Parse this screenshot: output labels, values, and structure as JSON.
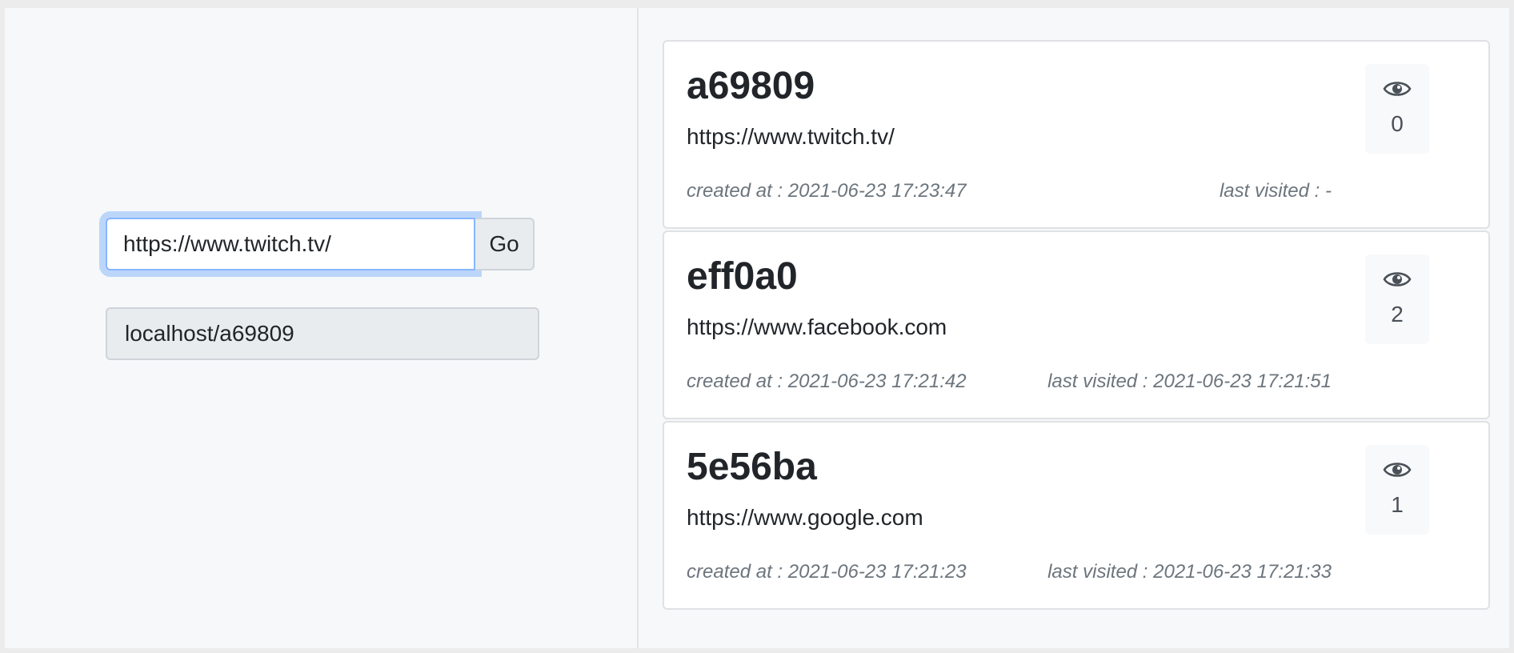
{
  "shortener": {
    "url_input_value": "https://www.twitch.tv/",
    "go_label": "Go",
    "short_url_result": "localhost/a69809"
  },
  "links": [
    {
      "code": "a69809",
      "url": "https://www.twitch.tv/",
      "created": "created at : 2021-06-23 17:23:47",
      "last_visited": "last visited : -",
      "views": "0"
    },
    {
      "code": "eff0a0",
      "url": "https://www.facebook.com",
      "created": "created at : 2021-06-23 17:21:42",
      "last_visited": "last visited : 2021-06-23 17:21:51",
      "views": "2"
    },
    {
      "code": "5e56ba",
      "url": "https://www.google.com",
      "created": "created at : 2021-06-23 17:21:23",
      "last_visited": "last visited : 2021-06-23 17:21:33",
      "views": "1"
    }
  ],
  "icons": {
    "views": "eye-icon"
  },
  "colors": {
    "focus_ring": "#86b7fe",
    "page_background": "#f7f8fa",
    "muted_text": "#6c757d"
  }
}
